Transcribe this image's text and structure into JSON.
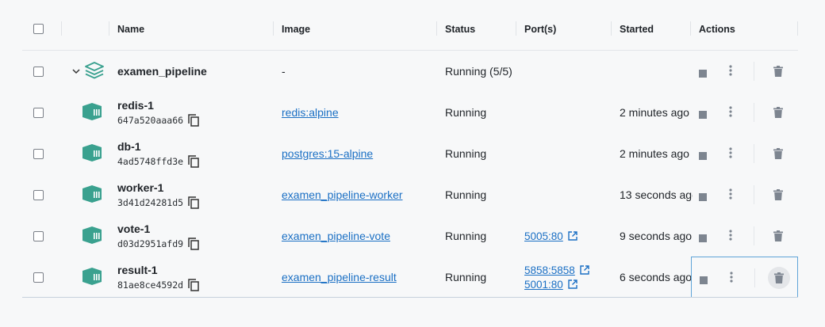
{
  "header": {
    "name": "Name",
    "image": "Image",
    "status": "Status",
    "ports": "Port(s)",
    "started": "Started",
    "actions": "Actions"
  },
  "group": {
    "name": "examen_pipeline",
    "image": "-",
    "status": "Running (5/5)"
  },
  "containers": [
    {
      "name": "redis-1",
      "id": "647a520aaa66",
      "image": "redis:alpine",
      "status": "Running",
      "ports": [],
      "started": "2 minutes ago"
    },
    {
      "name": "db-1",
      "id": "4ad5748ffd3e",
      "image": "postgres:15-alpine",
      "status": "Running",
      "ports": [],
      "started": "2 minutes ago"
    },
    {
      "name": "worker-1",
      "id": "3d41d24281d5",
      "image": "examen_pipeline-worker",
      "status": "Running",
      "ports": [],
      "started": "13 seconds ago"
    },
    {
      "name": "vote-1",
      "id": "d03d2951afd9",
      "image": "examen_pipeline-vote",
      "status": "Running",
      "ports": [
        "5005:80"
      ],
      "started": "9 seconds ago"
    },
    {
      "name": "result-1",
      "id": "81ae8ce4592d",
      "image": "examen_pipeline-result",
      "status": "Running",
      "ports": [
        "5858:5858",
        "5001:80"
      ],
      "started": "6 seconds ago"
    }
  ],
  "icons": {
    "stack": "stack-icon",
    "container": "container-icon",
    "copy": "copy-icon",
    "external": "external-link-icon",
    "stop": "stop-icon",
    "more": "more-vertical-icon",
    "delete": "trash-icon",
    "chevron": "chevron-down-icon"
  },
  "colors": {
    "accent": "#1a6fc4",
    "container_icon": "#3aa18f",
    "action_icon": "#7d8590",
    "focus_border": "#5fa4d8"
  }
}
